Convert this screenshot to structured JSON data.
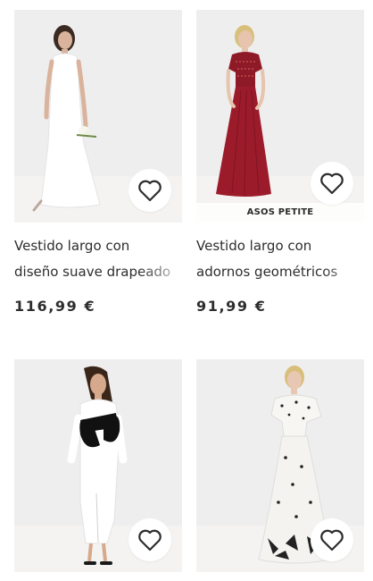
{
  "products": [
    {
      "title_line1": "Vestido largo con",
      "title_line2": "diseño suave drapeado",
      "price": "116,99 €",
      "badge": "",
      "favorite_icon": "heart-icon",
      "dress_color": "#ffffff"
    },
    {
      "title_line1": "Vestido largo con",
      "title_line2": "adornos geométricos",
      "price": "91,99 €",
      "badge": "ASOS PETITE",
      "favorite_icon": "heart-icon",
      "dress_color": "#9b1b2a"
    },
    {
      "title_line1": "",
      "title_line2": "",
      "price": "",
      "badge": "",
      "favorite_icon": "heart-icon",
      "dress_color": "#ffffff"
    },
    {
      "title_line1": "",
      "title_line2": "",
      "price": "",
      "badge": "",
      "favorite_icon": "heart-icon",
      "dress_color": "#f2f2f0"
    }
  ]
}
